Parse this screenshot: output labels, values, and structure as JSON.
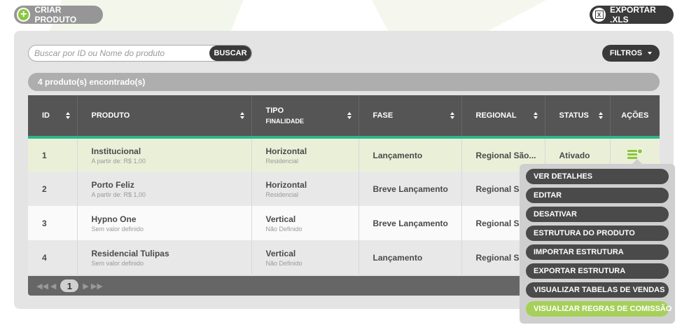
{
  "toolbar": {
    "create_label": "CRIAR PRODUTO",
    "export_label": "EXPORTAR .XLS"
  },
  "search": {
    "placeholder": "Buscar por ID ou Nome do produto",
    "button_label": "BUSCAR"
  },
  "filters": {
    "label": "FILTROS"
  },
  "results": {
    "count_text": "4 produto(s) encontrado(s)"
  },
  "table": {
    "headers": {
      "id": "ID",
      "produto": "PRODUTO",
      "tipo": "TIPO",
      "tipo_sub": "FINALIDADE",
      "fase": "FASE",
      "regional": "REGIONAL",
      "status": "STATUS",
      "acoes": "AÇÕES"
    },
    "rows": [
      {
        "id": "1",
        "produto": "Institucional",
        "produto_sub": "A partir de: R$ 1,00",
        "tipo": "Horizontal",
        "tipo_sub": "Residencial",
        "fase": "Lançamento",
        "regional": "Regional São...",
        "status": "Ativado"
      },
      {
        "id": "2",
        "produto": "Porto Feliz",
        "produto_sub": "A partir de: R$ 1,00",
        "tipo": "Horizontal",
        "tipo_sub": "Residencial",
        "fase": "Breve Lançamento",
        "regional": "Regional São",
        "status": ""
      },
      {
        "id": "3",
        "produto": "Hypno One",
        "produto_sub": "Sem valor definido",
        "tipo": "Vertical",
        "tipo_sub": "Não Definido",
        "fase": "Breve Lançamento",
        "regional": "Regional São",
        "status": ""
      },
      {
        "id": "4",
        "produto": "Residencial Tulipas",
        "produto_sub": "Sem valor definido",
        "tipo": "Vertical",
        "tipo_sub": "Não Definido",
        "fase": "Lançamento",
        "regional": "Regional São",
        "status": ""
      }
    ]
  },
  "pagination": {
    "current_page": "1"
  },
  "actions_menu": {
    "items": [
      "VER DETALHES",
      "EDITAR",
      "DESATIVAR",
      "ESTRUTURA DO PRODUTO",
      "IMPORTAR ESTRUTURA",
      "EXPORTAR ESTRUTURA",
      "VISUALIZAR TABELAS DE VENDAS",
      "VISUALIZAR REGRAS DE COMISSÃO"
    ],
    "highlighted_item": "VISUALIZAR REGRAS DE COMISSÃO"
  },
  "colors": {
    "accent_green": "#8cc63f",
    "header_underline": "#2fb58a",
    "dark": "#3a3a3a",
    "selected_row": "#eaf0d8",
    "menu_highlight": "#a6d05a"
  }
}
